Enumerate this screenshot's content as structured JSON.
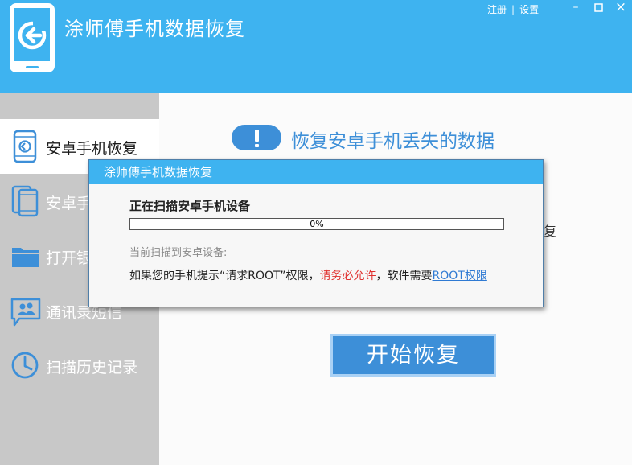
{
  "header": {
    "app_title": "涂师傅手机数据恢复",
    "register_link": "注册",
    "link_separator": "|",
    "settings_link": "设置",
    "window_buttons": {
      "minimize": "–",
      "close": "×"
    }
  },
  "sidebar": {
    "items": [
      {
        "label": "安卓手机恢复",
        "icon": "android-phone-restore-icon",
        "active": true
      },
      {
        "label": "安卓手",
        "icon": "phone-backup-icon",
        "active": false
      },
      {
        "label": "打开银",
        "icon": "folder-icon",
        "active": false
      },
      {
        "label": "通讯录短信",
        "icon": "contacts-sms-icon",
        "active": false
      },
      {
        "label": "扫描历史记录",
        "icon": "clock-icon",
        "active": false
      }
    ]
  },
  "main": {
    "heading": "恢复安卓手机丢失的数据",
    "partial_char": "复",
    "start_button": "开始恢复"
  },
  "dialog": {
    "title": "涂师傅手机数据恢复",
    "scan_title": "正在扫描安卓手机设备",
    "progress_value": 0,
    "progress_text": "0%",
    "device_label": "当前扫描到安卓设备:",
    "root_notice_prefix": "如果您的手机提示“请求ROOT”权限，",
    "root_notice_warning": "请务必允许",
    "root_notice_middle": "，软件需要",
    "root_link": "ROOT权限"
  },
  "colors": {
    "header_blue": "#3eb3f0",
    "accent_blue": "#3d8fd8",
    "sidebar_gray": "#c8c8c8",
    "warning_red": "#e0302f",
    "link_blue": "#2f7ad3"
  }
}
